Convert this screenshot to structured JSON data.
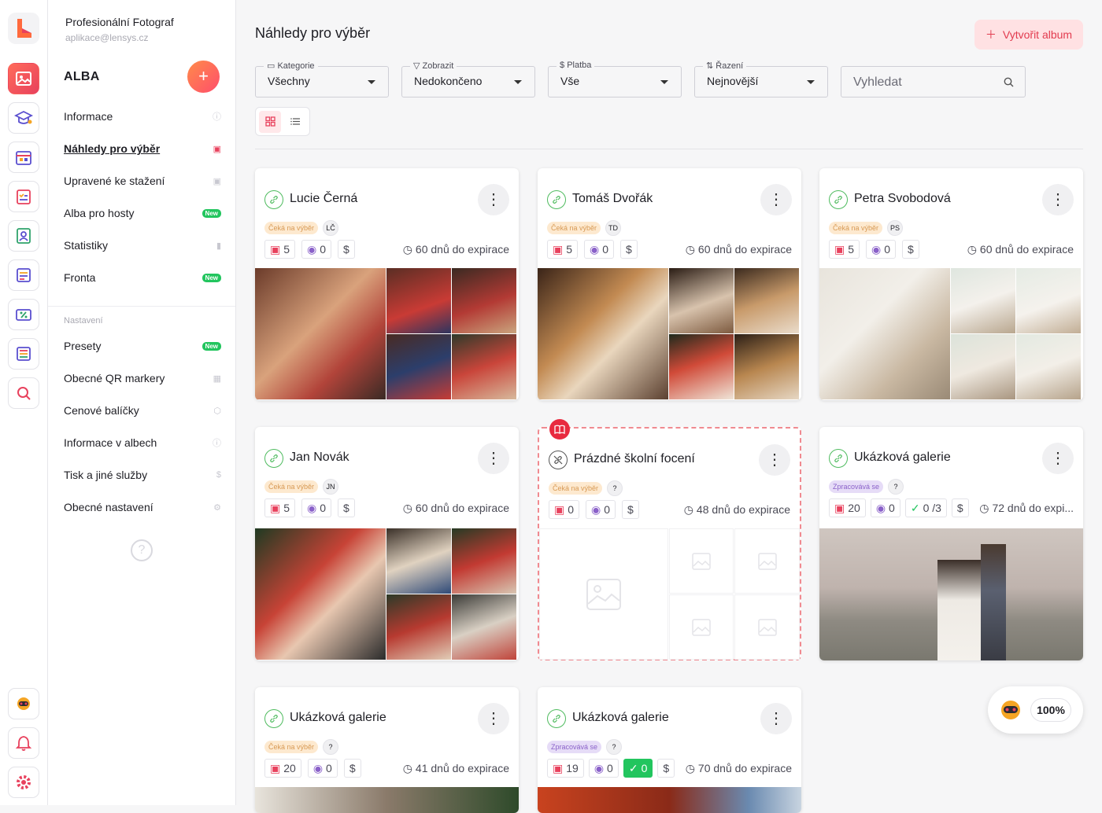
{
  "account": {
    "name": "Profesionální Fotograf",
    "email": "aplikace@lensys.cz"
  },
  "sidebar": {
    "heading": "ALBA",
    "add_label": "+",
    "items": [
      {
        "label": "Informace",
        "badge": ""
      },
      {
        "label": "Náhledy pro výběr",
        "badge": ""
      },
      {
        "label": "Upravené ke stažení",
        "badge": ""
      },
      {
        "label": "Alba pro hosty",
        "badge": "New"
      },
      {
        "label": "Statistiky",
        "badge": ""
      },
      {
        "label": "Fronta",
        "badge": "New"
      }
    ],
    "section": "Nastavení",
    "settings": [
      {
        "label": "Presety",
        "badge": "New"
      },
      {
        "label": "Obecné QR markery",
        "badge": ""
      },
      {
        "label": "Cenové balíčky",
        "badge": ""
      },
      {
        "label": "Informace v albech",
        "badge": ""
      },
      {
        "label": "Tisk a jiné služby",
        "badge": ""
      },
      {
        "label": "Obecné nastavení",
        "badge": ""
      }
    ],
    "help": "?"
  },
  "page": {
    "title": "Náhledy pro výběr",
    "create_label": "Vytvořit album"
  },
  "filters": [
    {
      "label": "Kategorie",
      "value": "Všechny"
    },
    {
      "label": "Zobrazit",
      "value": "Nedokončeno"
    },
    {
      "label": "Platba",
      "value": "Vše"
    },
    {
      "label": "Řazení",
      "value": "Nejnovější"
    }
  ],
  "search": {
    "placeholder": "Vyhledat"
  },
  "albums": [
    {
      "name": "Lucie Černá",
      "status": "Čeká na výběr",
      "initials": "LČ",
      "photos": "5",
      "views": "0",
      "currency": "$",
      "approvals": "",
      "expiry": "60 dnů do expirace"
    },
    {
      "name": "Tomáš Dvořák",
      "status": "Čeká na výběr",
      "initials": "TD",
      "photos": "5",
      "views": "0",
      "currency": "$",
      "approvals": "",
      "expiry": "60 dnů do expirace"
    },
    {
      "name": "Petra Svobodová",
      "status": "Čeká na výběr",
      "initials": "PS",
      "photos": "5",
      "views": "0",
      "currency": "$",
      "approvals": "",
      "expiry": "60 dnů do expirace"
    },
    {
      "name": "Jan Novák",
      "status": "Čeká na výběr",
      "initials": "JN",
      "photos": "5",
      "views": "0",
      "currency": "$",
      "approvals": "",
      "expiry": "60 dnů do expirace"
    },
    {
      "name": "Prázdné školní focení",
      "status": "Čeká na výběr",
      "initials": "?",
      "photos": "0",
      "views": "0",
      "currency": "$",
      "approvals": "",
      "expiry": "48 dnů do expirace"
    },
    {
      "name": "Ukázková galerie",
      "status": "Zpracovává se",
      "initials": "?",
      "photos": "20",
      "views": "0",
      "currency": "$",
      "approvals": "0 /3",
      "expiry": "72 dnů do expi..."
    },
    {
      "name": "Ukázková galerie",
      "status": "Čeká na výběr",
      "initials": "?",
      "photos": "20",
      "views": "0",
      "currency": "$",
      "approvals": "",
      "expiry": "41 dnů do expirace"
    },
    {
      "name": "Ukázková galerie",
      "status": "Zpracovává se",
      "initials": "?",
      "photos": "19",
      "views": "0",
      "currency": "$",
      "approvals": "0",
      "expiry": "70 dnů do expirace"
    }
  ],
  "zoom": {
    "value": "100%"
  },
  "colors": {
    "accent": "#e8415d",
    "success": "#22c55e",
    "pending_bg": "#fde9cf",
    "processing_bg": "#e6dcf7"
  }
}
